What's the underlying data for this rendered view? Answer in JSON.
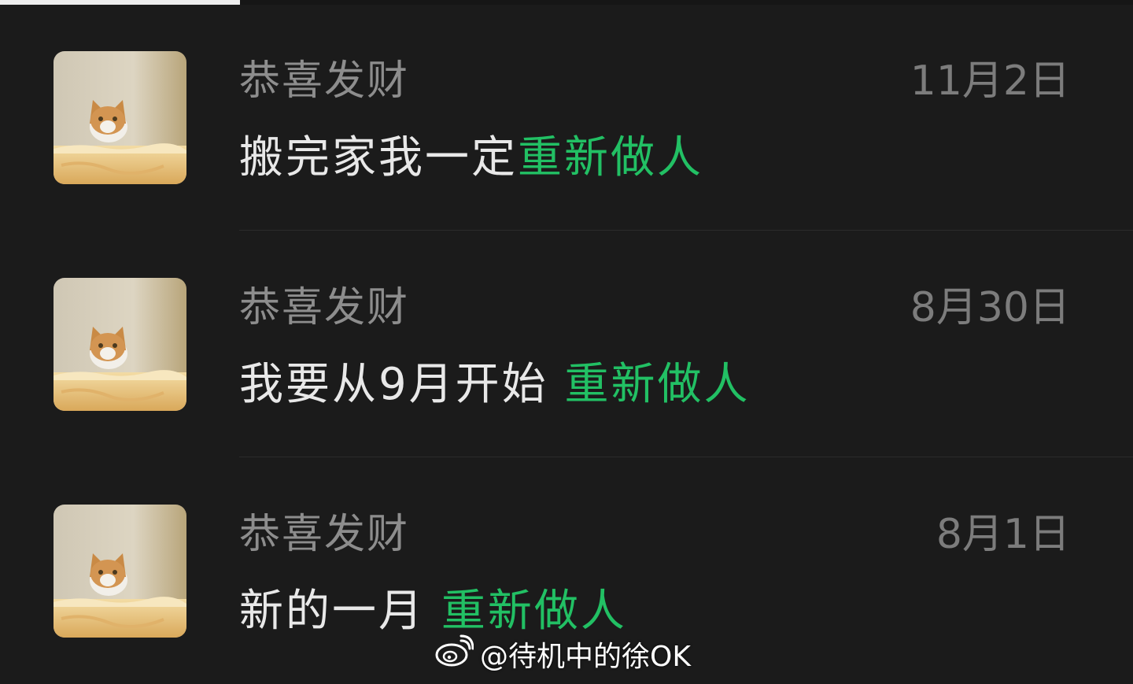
{
  "conversations": [
    {
      "name": "恭喜发财",
      "date": "11月2日",
      "message_prefix": "搬完家我一定",
      "message_highlight": "重新做人"
    },
    {
      "name": "恭喜发财",
      "date": "8月30日",
      "message_prefix": "我要从9月开始 ",
      "message_highlight": "重新做人"
    },
    {
      "name": "恭喜发财",
      "date": "8月1日",
      "message_prefix": "新的一月 ",
      "message_highlight": "重新做人"
    }
  ],
  "watermark": {
    "icon": "weibo-icon",
    "text": "@待机中的徐OK"
  },
  "colors": {
    "background": "#1b1b1b",
    "name_text": "#8d8d8d",
    "date_text": "#7c7c7c",
    "message_text": "#e8e8e8",
    "highlight": "#22c064"
  }
}
